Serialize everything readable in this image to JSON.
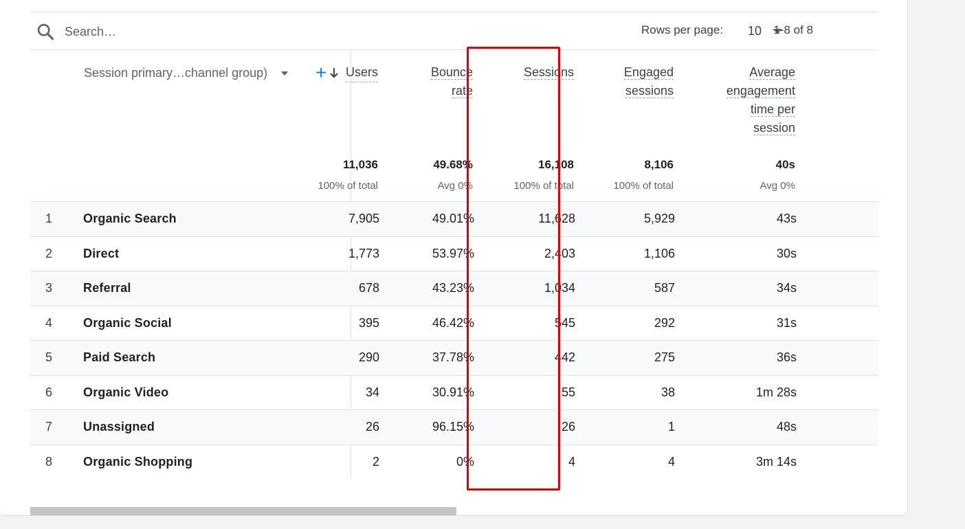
{
  "search": {
    "placeholder": "Search…",
    "value": ""
  },
  "pager": {
    "rows_per_page_label": "Rows per page:",
    "rows_per_page_value": "10",
    "range_text": "1-8 of 8"
  },
  "dimension": {
    "label": "Session primary…channel group)"
  },
  "columns": {
    "users": {
      "label": "Users",
      "total": "11,036",
      "sub": "100% of total"
    },
    "bounce_rate": {
      "line1": "Bounce",
      "line2": "rate",
      "total": "49.68%",
      "sub": "Avg 0%"
    },
    "sessions": {
      "label": "Sessions",
      "total": "16,108",
      "sub": "100% of total"
    },
    "engaged_sessions": {
      "line1": "Engaged",
      "line2": "sessions",
      "total": "8,106",
      "sub": "100% of total"
    },
    "avg_engagement": {
      "line1": "Average",
      "line2": "engagement",
      "line3": "time per",
      "line4": "session",
      "total": "40s",
      "sub": "Avg 0%"
    }
  },
  "rows": [
    {
      "idx": "1",
      "name": "Organic Search",
      "users": "7,905",
      "bounce": "49.01%",
      "sessions": "11,628",
      "engaged": "5,929",
      "avg_time": "43s"
    },
    {
      "idx": "2",
      "name": "Direct",
      "users": "1,773",
      "bounce": "53.97%",
      "sessions": "2,403",
      "engaged": "1,106",
      "avg_time": "30s"
    },
    {
      "idx": "3",
      "name": "Referral",
      "users": "678",
      "bounce": "43.23%",
      "sessions": "1,034",
      "engaged": "587",
      "avg_time": "34s"
    },
    {
      "idx": "4",
      "name": "Organic Social",
      "users": "395",
      "bounce": "46.42%",
      "sessions": "545",
      "engaged": "292",
      "avg_time": "31s"
    },
    {
      "idx": "5",
      "name": "Paid Search",
      "users": "290",
      "bounce": "37.78%",
      "sessions": "442",
      "engaged": "275",
      "avg_time": "36s"
    },
    {
      "idx": "6",
      "name": "Organic Video",
      "users": "34",
      "bounce": "30.91%",
      "sessions": "55",
      "engaged": "38",
      "avg_time": "1m 28s"
    },
    {
      "idx": "7",
      "name": "Unassigned",
      "users": "26",
      "bounce": "96.15%",
      "sessions": "26",
      "engaged": "1",
      "avg_time": "48s"
    },
    {
      "idx": "8",
      "name": "Organic Shopping",
      "users": "2",
      "bounce": "0%",
      "sessions": "4",
      "engaged": "4",
      "avg_time": "3m 14s"
    }
  ],
  "icons": {
    "search": "search-icon",
    "sort": "arrow-down-icon",
    "add": "plus-icon",
    "dropdown": "caret-down-icon"
  },
  "colors": {
    "accent": "#1a73e8",
    "highlight_box": "#e00000"
  }
}
